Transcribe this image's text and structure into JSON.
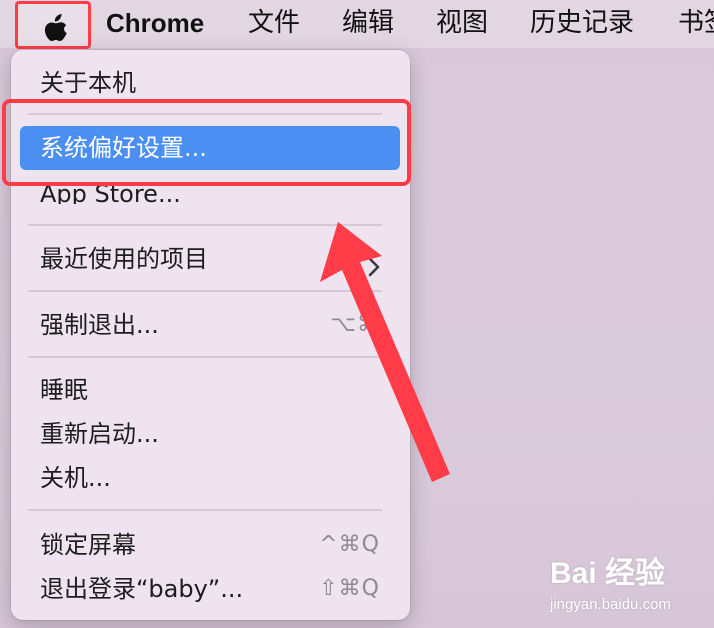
{
  "menubar": {
    "app_name": "Chrome",
    "items": [
      "文件",
      "编辑",
      "视图",
      "历史记录",
      "书签"
    ]
  },
  "apple_menu": {
    "about": "关于本机",
    "system_prefs": "系统偏好设置...",
    "app_store": "App Store...",
    "recent_items": "最近使用的项目",
    "force_quit": "强制退出...",
    "force_quit_shortcut": "⌥⌘",
    "sleep": "睡眠",
    "restart": "重新启动...",
    "shutdown": "关机...",
    "lock_screen": "锁定屏幕",
    "lock_screen_shortcut": "^⌘Q",
    "log_out": "退出登录“baby”...",
    "log_out_shortcut": "⇧⌘Q"
  },
  "watermark": {
    "brand": "Bai 经验",
    "site": "jingyan.baidu.com"
  },
  "colors": {
    "highlight": "#4a8ff1",
    "annotation_red": "#ff3c48",
    "menu_bg": "#eee3ef"
  }
}
